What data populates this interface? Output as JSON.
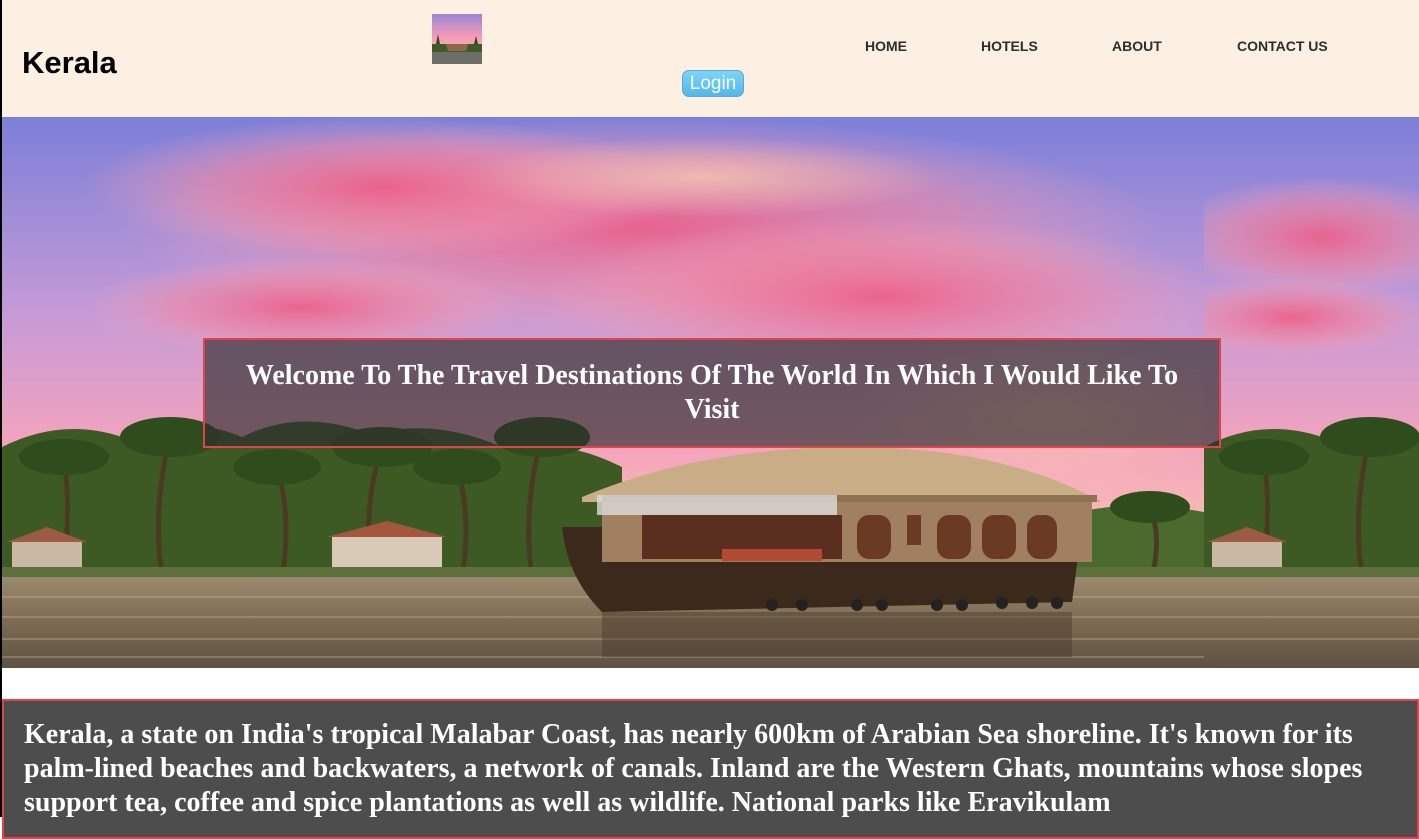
{
  "header": {
    "brand": "Kerala",
    "nav": [
      "HOME",
      "HOTELS",
      "ABOUT",
      "CONTACT US"
    ],
    "login_label": "Login"
  },
  "hero": {
    "welcome_text": "Welcome To The Travel Destinations Of The World In Which I Would Like To Visit"
  },
  "description": {
    "text": "Kerala, a state on India's tropical Malabar Coast, has nearly 600km of Arabian Sea shoreline. It's known for its palm-lined beaches and backwaters, a network of canals. Inland are the Western Ghats, mountains whose slopes support tea, coffee and spice plantations as well as wildlife. National parks like Eravikulam"
  },
  "colors": {
    "header_bg": "#fcf0e3",
    "login_bg": "#4fb8ec",
    "overlay_border": "#e0444b",
    "description_bg": "#4d4d4d"
  }
}
